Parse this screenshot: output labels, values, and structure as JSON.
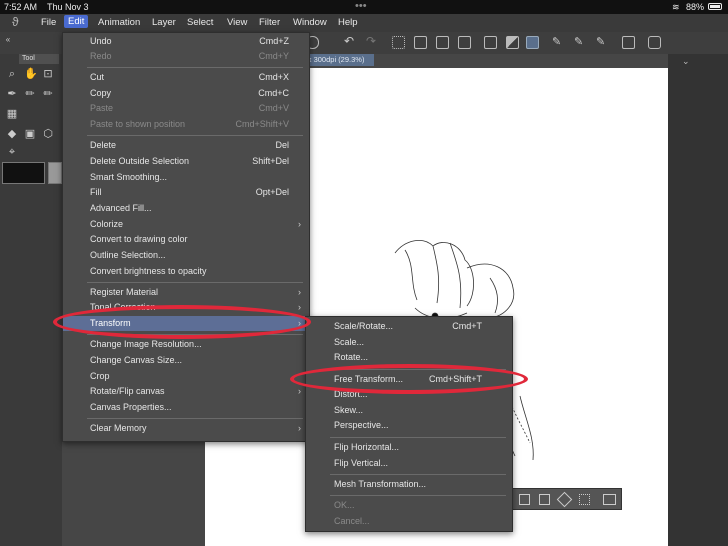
{
  "status": {
    "time": "7:52 AM",
    "date": "Thu Nov 3",
    "dots": "•••",
    "battery": "88%"
  },
  "menubar": {
    "items": [
      "File",
      "Edit",
      "Animation",
      "Layer",
      "Select",
      "View",
      "Filter",
      "Window",
      "Help"
    ]
  },
  "panel": {
    "tool_tab": "Tool"
  },
  "canvas": {
    "tab_label": "cx 300dpi (29.3%)"
  },
  "edit_menu": {
    "items": [
      {
        "label": "Undo",
        "shortcut": "Cmd+Z"
      },
      {
        "label": "Redo",
        "shortcut": "Cmd+Y"
      },
      {
        "label": "Cut",
        "shortcut": "Cmd+X"
      },
      {
        "label": "Copy",
        "shortcut": "Cmd+C"
      },
      {
        "label": "Paste",
        "shortcut": "Cmd+V"
      },
      {
        "label": "Paste to shown position",
        "shortcut": "Cmd+Shift+V"
      },
      {
        "label": "Delete",
        "shortcut": "Del"
      },
      {
        "label": "Delete Outside Selection",
        "shortcut": "Shift+Del"
      },
      {
        "label": "Smart Smoothing..."
      },
      {
        "label": "Fill",
        "shortcut": "Opt+Del"
      },
      {
        "label": "Advanced Fill..."
      },
      {
        "label": "Colorize"
      },
      {
        "label": "Convert to drawing color"
      },
      {
        "label": "Outline Selection..."
      },
      {
        "label": "Convert brightness to opacity"
      },
      {
        "label": "Register Material"
      },
      {
        "label": "Tonal Correction"
      },
      {
        "label": "Transform"
      },
      {
        "label": "Change Image Resolution..."
      },
      {
        "label": "Change Canvas Size..."
      },
      {
        "label": "Crop"
      },
      {
        "label": "Rotate/Flip canvas"
      },
      {
        "label": "Canvas Properties..."
      },
      {
        "label": "Clear Memory"
      }
    ]
  },
  "transform_menu": {
    "items": [
      {
        "label": "Scale/Rotate...",
        "shortcut": "Cmd+T"
      },
      {
        "label": "Scale..."
      },
      {
        "label": "Rotate..."
      },
      {
        "label": "Free Transform...",
        "shortcut": "Cmd+Shift+T"
      },
      {
        "label": "Distort..."
      },
      {
        "label": "Skew..."
      },
      {
        "label": "Perspective..."
      },
      {
        "label": "Flip Horizontal..."
      },
      {
        "label": "Flip Vertical..."
      },
      {
        "label": "Mesh Transformation..."
      },
      {
        "label": "OK..."
      },
      {
        "label": "Cancel..."
      }
    ]
  },
  "colors": {
    "highlight": "#5d6e96",
    "ring": "#e0283a",
    "accent": "#4a6bd0"
  }
}
